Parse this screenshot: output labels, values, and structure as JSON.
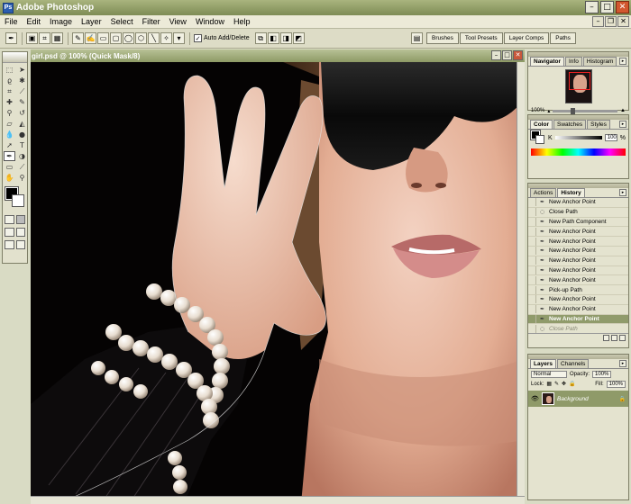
{
  "window": {
    "title": "Adobe Photoshop",
    "app_icon": "Ps"
  },
  "menu": [
    "File",
    "Edit",
    "Image",
    "Layer",
    "Select",
    "Filter",
    "View",
    "Window",
    "Help"
  ],
  "options": {
    "auto_add_label": "Auto Add/Delete",
    "auto_add_checked": "✓"
  },
  "palette_well": [
    "Brushes",
    "Tool Presets",
    "Layer Comps",
    "Paths"
  ],
  "document": {
    "title": "girl.psd @ 100% (Quick Mask/8)"
  },
  "navigator": {
    "tabs": [
      "Navigator",
      "Info",
      "Histogram"
    ],
    "zoom": "100%",
    "zoom_fraction": 0.28
  },
  "color": {
    "tabs": [
      "Color",
      "Swatches",
      "Styles"
    ],
    "channel": "K",
    "value": "100",
    "unit": "%"
  },
  "history": {
    "tabs": [
      "Actions",
      "History"
    ],
    "items": [
      "New Anchor Point",
      "Close Path",
      "New Path Component",
      "New Anchor Point",
      "New Anchor Point",
      "New Anchor Point",
      "New Anchor Point",
      "New Anchor Point",
      "New Anchor Point",
      "Pick-up Path",
      "New Anchor Point",
      "New Anchor Point",
      "New Anchor Point",
      "Close Path"
    ],
    "selected_index": 12,
    "dimmed_index": 13
  },
  "layers": {
    "tabs": [
      "Layers",
      "Channels"
    ],
    "blend_mode": "Normal",
    "opacity_label": "Opacity:",
    "opacity": "100%",
    "lock_label": "Lock:",
    "fill_label": "Fill:",
    "fill": "100%",
    "layer_name": "Background"
  },
  "colors": {
    "accent": "#909b6b",
    "titlebar": "#8d9a65",
    "canvas_bg": "#050303"
  }
}
